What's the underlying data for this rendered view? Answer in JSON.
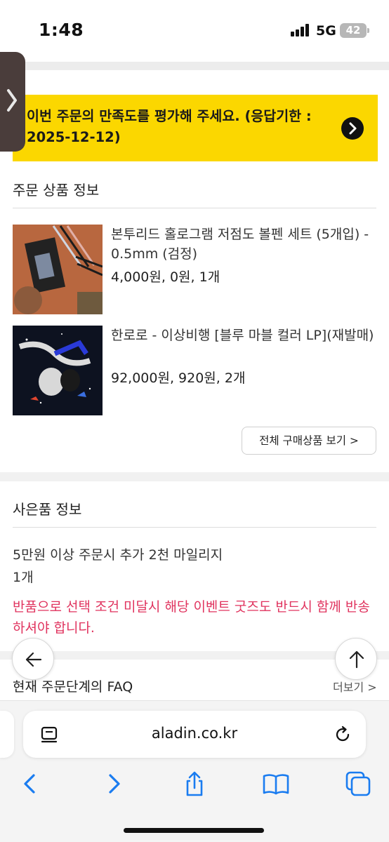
{
  "status_bar": {
    "time": "1:48",
    "network": "5G",
    "battery": "42"
  },
  "banner": {
    "text": "이번 주문의 만족도를 평가해 주세요. (응답기한 : 2025-12-12)"
  },
  "order_products": {
    "title": "주문 상품 정보",
    "items": [
      {
        "name": "본투리드 홀로그램 저점도 볼펜 세트 (5개입) - 0.5mm (검정)",
        "price_line": "4,000원, 0원, 1개"
      },
      {
        "name": "한로로 - 이상비행 [블루 마블 컬러 LP](재발매)",
        "price_line": "92,000원, 920원, 2개"
      }
    ],
    "view_all_label": "전체 구매상품 보기 >"
  },
  "gift": {
    "title": "사은품 정보",
    "item": "5만원 이상 주문시 추가 2천 마일리지",
    "count": "1개",
    "notice": "반품으로 선택 조건 미달시 해당 이벤트 굿즈도 반드시 함께 반송하셔야 합니다."
  },
  "faq": {
    "title": "현재 주문단계의 FAQ",
    "more_label": "더보기 >"
  },
  "browser": {
    "url": "aladin.co.kr"
  },
  "colors": {
    "banner_bg": "#fbd700",
    "notice_red": "#e0335e",
    "ios_blue": "#1a7cf0"
  },
  "icons": [
    "chevron-right-icon",
    "arrow-right-circle-icon",
    "back-arrow-icon",
    "up-arrow-icon",
    "reader-icon",
    "reload-icon",
    "back-chevron-icon",
    "forward-chevron-icon",
    "share-icon",
    "bookmarks-icon",
    "tabs-icon"
  ]
}
